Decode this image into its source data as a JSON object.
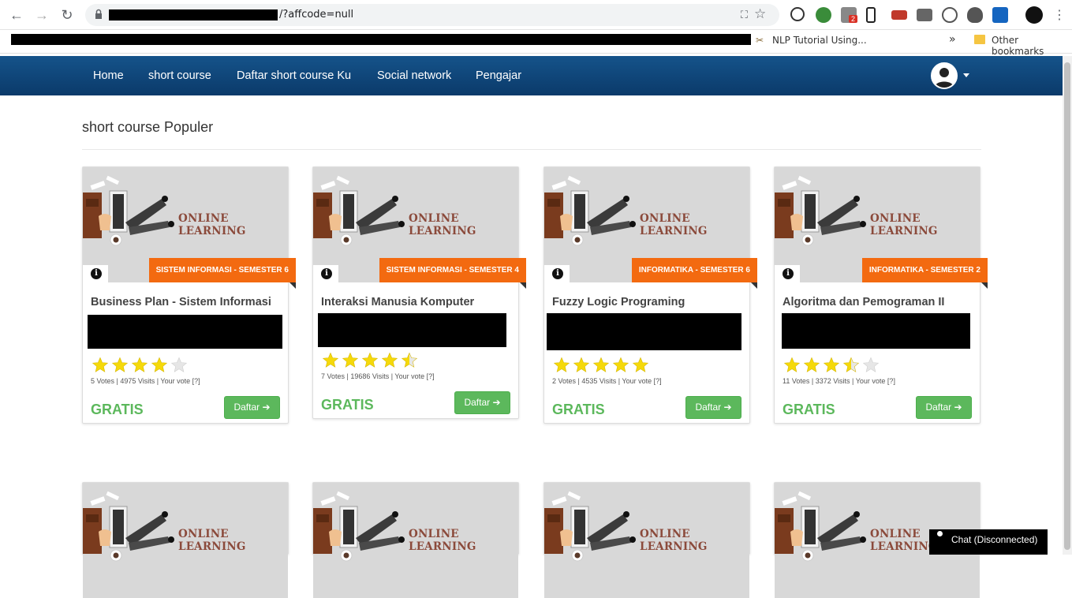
{
  "browser": {
    "url_suffix": "/?affcode=null",
    "bookmark_nlp": "NLP Tutorial Using...",
    "bookmark_more": "»",
    "other_bookmarks": "Other bookmarks",
    "ext_badge": "2"
  },
  "nav": {
    "items": [
      "Home",
      "short course",
      "Daftar short course Ku",
      "Social network",
      "Pengajar"
    ]
  },
  "section_title": "short course Populer",
  "thumbnail_text": "ONLINE LEARNING",
  "courses": [
    {
      "badge": "SISTEM INFORMASI - SEMESTER 6",
      "title": "Business Plan - Sistem Informasi",
      "rating": 4,
      "votes_text": "5 Votes | 4975 Visits | Your vote [?]",
      "price": "GRATIS",
      "button": "Daftar"
    },
    {
      "badge": "SISTEM INFORMASI - SEMESTER 4",
      "title": "Interaksi Manusia Komputer",
      "rating": 4.5,
      "votes_text": "7 Votes | 19686 Visits | Your vote [?]",
      "price": "GRATIS",
      "button": "Daftar"
    },
    {
      "badge": "INFORMATIKA - SEMESTER 6",
      "title": "Fuzzy Logic Programing",
      "rating": 5,
      "votes_text": "2 Votes | 4535 Visits | Your vote [?]",
      "price": "GRATIS",
      "button": "Daftar"
    },
    {
      "badge": "INFORMATIKA - SEMESTER 2",
      "title": "Algoritma dan Pemograman II",
      "rating": 3.5,
      "votes_text": "11 Votes | 3372 Visits | Your vote [?]",
      "price": "GRATIS",
      "button": "Daftar"
    }
  ],
  "chat": {
    "label": "Chat (Disconnected)"
  },
  "colors": {
    "nav": "#0b3a6a",
    "badge": "#f36a10",
    "green": "#5cb85c",
    "star": "#f5d90a"
  }
}
